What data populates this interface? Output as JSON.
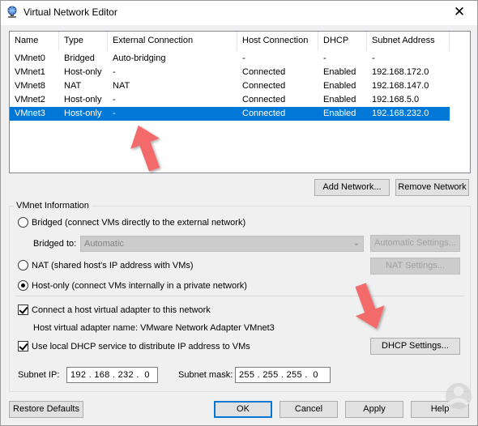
{
  "window": {
    "title": "Virtual Network Editor",
    "close_glyph": "✕"
  },
  "table": {
    "columns": [
      "Name",
      "Type",
      "External Connection",
      "Host Connection",
      "DHCP",
      "Subnet Address"
    ],
    "rows": [
      [
        "VMnet0",
        "Bridged",
        "Auto-bridging",
        "-",
        "-",
        "-"
      ],
      [
        "VMnet1",
        "Host-only",
        "-",
        "Connected",
        "Enabled",
        "192.168.172.0"
      ],
      [
        "VMnet8",
        "NAT",
        "NAT",
        "Connected",
        "Enabled",
        "192.168.147.0"
      ],
      [
        "VMnet2",
        "Host-only",
        "-",
        "Connected",
        "Enabled",
        "192.168.5.0"
      ],
      [
        "VMnet3",
        "Host-only",
        "-",
        "Connected",
        "Enabled",
        "192.168.232.0"
      ]
    ],
    "selected_row": 4
  },
  "buttons": {
    "add_network": "Add Network...",
    "remove_network": "Remove Network",
    "automatic_settings": "Automatic Settings...",
    "nat_settings": "NAT Settings...",
    "dhcp_settings": "DHCP Settings...",
    "restore_defaults": "Restore Defaults",
    "ok": "OK",
    "cancel": "Cancel",
    "apply": "Apply",
    "help": "Help"
  },
  "vmnet_info": {
    "group_title": "VMnet Information",
    "bridged_label": "Bridged (connect VMs directly to the external network)",
    "bridged_to_label": "Bridged to:",
    "bridged_to_value": "Automatic",
    "nat_label": "NAT (shared host's IP address with VMs)",
    "hostonly_label": "Host-only (connect VMs internally in a private network)",
    "selected_mode": "host-only",
    "connect_adapter_label": "Connect a host virtual adapter to this network",
    "connect_adapter_checked": true,
    "adapter_name_label": "Host virtual adapter name: VMware Network Adapter VMnet3",
    "dhcp_label": "Use local DHCP service to distribute IP address to VMs",
    "dhcp_checked": true,
    "subnet_ip_label": "Subnet IP:",
    "subnet_ip_value": "192 . 168 . 232 .  0",
    "subnet_mask_label": "Subnet mask:",
    "subnet_mask_value": "255 . 255 . 255 .  0"
  },
  "colors": {
    "selection": "#0078d7",
    "annotation_arrow": "#f26a6a"
  }
}
